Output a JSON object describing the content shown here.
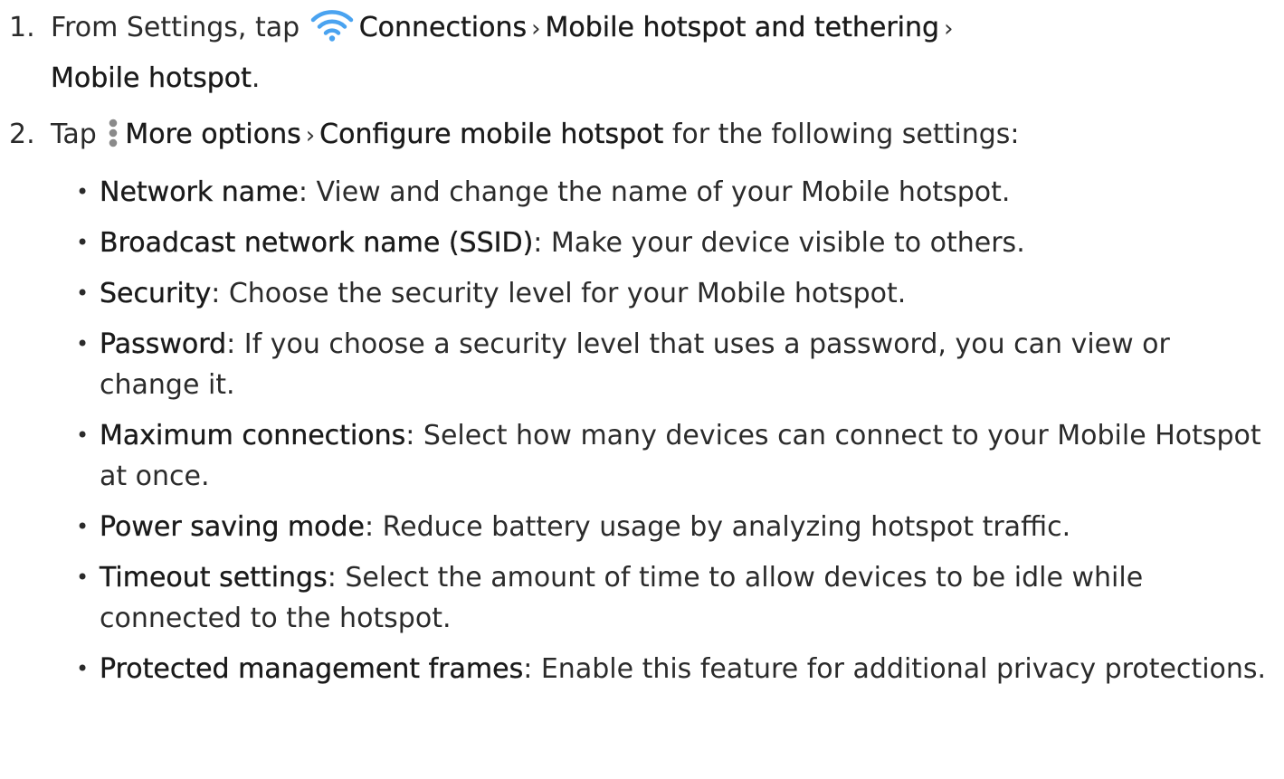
{
  "steps": [
    {
      "number": "1.",
      "line1": {
        "intro": "From Settings, tap ",
        "icon": "wifi-icon",
        "icon_color": "#4aa3f0",
        "item1": "Connections",
        "sep1": "›",
        "item2": "Mobile hotspot and tethering",
        "sep2": "›"
      },
      "line2": {
        "item3": "Mobile hotspot",
        "end": "."
      }
    },
    {
      "number": "2.",
      "intro": "Tap ",
      "icon": "more-options-icon",
      "icon_color": "#8a8a8a",
      "item1": "More options",
      "sep1": "›",
      "item2": "Configure mobile hotspot",
      "tail": " for the following settings:"
    }
  ],
  "settings": [
    {
      "name": "Network name",
      "desc": ": View and change the name of your Mobile hotspot."
    },
    {
      "name": "Broadcast network name (SSID)",
      "desc": ": Make your device visible to others."
    },
    {
      "name": "Security",
      "desc": ": Choose the security level for your Mobile hotspot."
    },
    {
      "name": "Password",
      "desc": ": If you choose a security level that uses a password, you can view or change it."
    },
    {
      "name": "Maximum connections",
      "desc": ": Select how many devices can connect to your Mobile Hotspot at once."
    },
    {
      "name": "Power saving mode",
      "desc": ": Reduce battery usage by analyzing hotspot traffic."
    },
    {
      "name": "Timeout settings",
      "desc": ": Select the amount of time to allow devices to be idle while connected to the hotspot."
    },
    {
      "name": "Protected management frames",
      "desc": ": Enable this feature for additional privacy protections."
    }
  ],
  "bullet_glyph": "•"
}
